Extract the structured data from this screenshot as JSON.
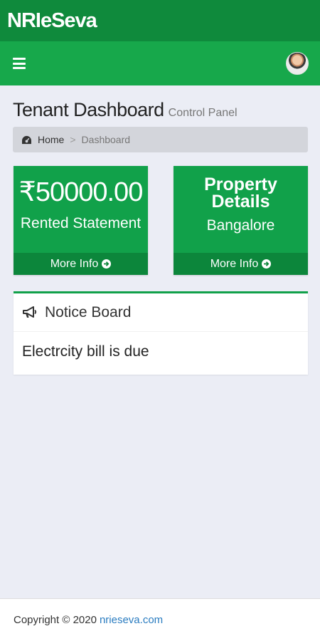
{
  "brand": {
    "title": "NRIeSeva"
  },
  "header": {
    "title": "Tenant Dashboard",
    "subtitle": "Control Panel"
  },
  "breadcrumb": {
    "home": "Home",
    "separator": ">",
    "current": "Dashboard"
  },
  "cards": [
    {
      "value": "₹50000.00",
      "label": "Rented Statement",
      "footer": "More Info"
    },
    {
      "heading_line1": "Property",
      "heading_line2": "Details",
      "label": "Bangalore",
      "footer": "More Info"
    }
  ],
  "notice": {
    "title": "Notice Board",
    "message": "Electrcity bill is due"
  },
  "footer": {
    "text": "Copyright © 2020",
    "link": "nrieseva.com"
  },
  "colors": {
    "brand_bar": "#0f8a3c",
    "nav_bar": "#17a84b",
    "card": "#11a14a",
    "card_footer": "#0c863b",
    "link": "#2a7cc0"
  },
  "icons": {
    "menu": "hamburger-icon",
    "breadcrumb": "dashboard-icon",
    "notice": "megaphone-icon",
    "more_info": "arrow-circle-right-icon"
  }
}
